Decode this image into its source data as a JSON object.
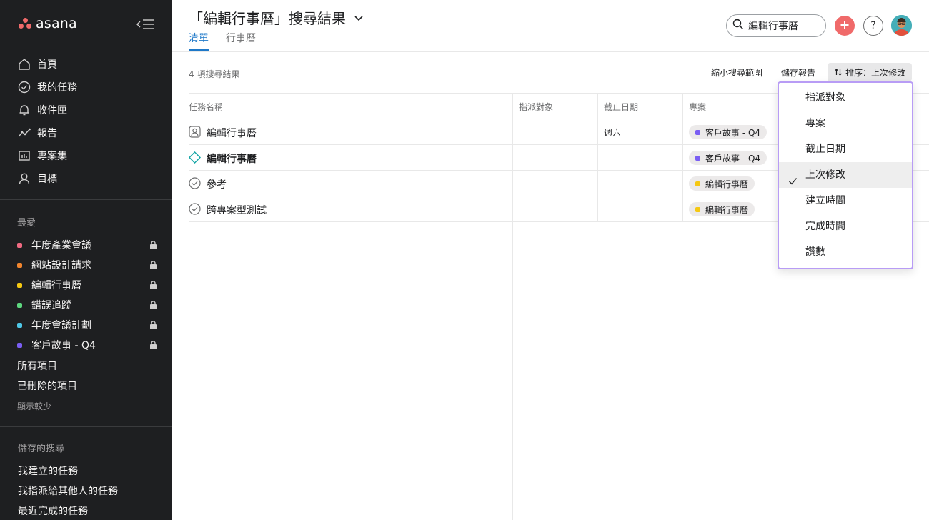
{
  "sidebar": {
    "logo": "asana",
    "nav": [
      {
        "label": "首頁",
        "icon": "home-icon"
      },
      {
        "label": "我的任務",
        "icon": "check-circle-icon"
      },
      {
        "label": "收件匣",
        "icon": "bell-icon"
      },
      {
        "label": "報告",
        "icon": "line-chart-icon"
      },
      {
        "label": "專案集",
        "icon": "bar-chart-icon"
      },
      {
        "label": "目標",
        "icon": "person-icon"
      }
    ],
    "favorites_title": "最愛",
    "favorites": [
      {
        "label": "年度產業會議",
        "color": "#f06a82"
      },
      {
        "label": "網站設計請求",
        "color": "#f1852e"
      },
      {
        "label": "編輯行事曆",
        "color": "#f5c812"
      },
      {
        "label": "錯誤追蹤",
        "color": "#5dd67e"
      },
      {
        "label": "年度會議計劃",
        "color": "#4ec6e6"
      },
      {
        "label": "客戶故事 - Q4",
        "color": "#7a5ef3"
      }
    ],
    "all_items": "所有項目",
    "deleted_items": "已刪除的項目",
    "show_less": "顯示較少",
    "saved_title": "儲存的搜尋",
    "saved": [
      "我建立的任務",
      "我指派給其他人的任務",
      "最近完成的任務"
    ]
  },
  "header": {
    "title": "「編輯行事曆」搜尋結果",
    "tabs": [
      "清單",
      "行事曆"
    ],
    "search_query": "編輯行事曆",
    "help": "?"
  },
  "toolbar": {
    "result_count": "4 項搜尋結果",
    "narrow": "縮小搜尋範圍",
    "save_report": "儲存報告",
    "sort_label": "排序：上次修改"
  },
  "table": {
    "columns": [
      "任務名稱",
      "指派對象",
      "截止日期",
      "專案"
    ],
    "rows": [
      {
        "name": "編輯行事曆",
        "icon": "person-template-icon",
        "due": "週六",
        "project": "客戶故事 - Q4",
        "project_color": "#7a5ef3",
        "bold": false
      },
      {
        "name": "編輯行事曆",
        "icon": "diamond-milestone-icon",
        "due": "",
        "project": "客戶故事 - Q4",
        "project_color": "#7a5ef3",
        "bold": true
      },
      {
        "name": "參考",
        "icon": "check-circle-icon",
        "due": "",
        "project": "編輯行事曆",
        "project_color": "#f5c812",
        "bold": false
      },
      {
        "name": "跨專案型測試",
        "icon": "check-circle-icon",
        "due": "",
        "project": "編輯行事曆",
        "project_color": "#f5c812",
        "bold": false
      }
    ]
  },
  "sort_menu": {
    "items": [
      "指派對象",
      "專案",
      "截止日期",
      "上次修改",
      "建立時間",
      "完成時間",
      "讚數"
    ],
    "selected": "上次修改"
  }
}
